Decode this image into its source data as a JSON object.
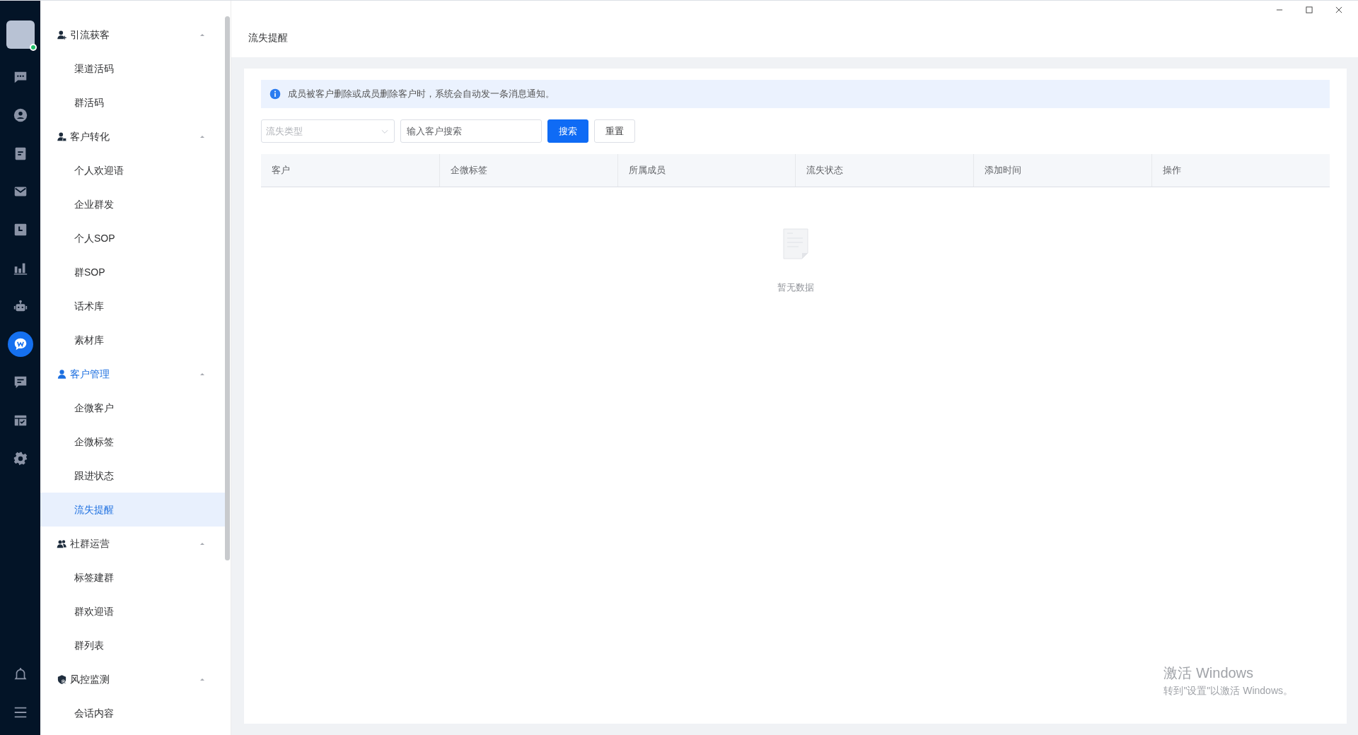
{
  "rail": {
    "items": [
      {
        "selected": false
      },
      {
        "selected": false
      },
      {
        "selected": false
      },
      {
        "selected": false
      },
      {
        "selected": false
      },
      {
        "selected": false
      },
      {
        "selected": false
      },
      {
        "selected": true
      },
      {
        "selected": false
      },
      {
        "selected": false
      },
      {
        "selected": false
      }
    ]
  },
  "sidebar": {
    "groups": [
      {
        "label": "引流获客",
        "expanded": true,
        "selected": false,
        "children": [
          {
            "label": "渠道活码",
            "selected": false
          },
          {
            "label": "群活码",
            "selected": false
          }
        ]
      },
      {
        "label": "客户转化",
        "expanded": true,
        "selected": false,
        "children": [
          {
            "label": "个人欢迎语",
            "selected": false
          },
          {
            "label": "企业群发",
            "selected": false
          },
          {
            "label": "个人SOP",
            "selected": false
          },
          {
            "label": "群SOP",
            "selected": false
          },
          {
            "label": "话术库",
            "selected": false
          },
          {
            "label": "素材库",
            "selected": false
          }
        ]
      },
      {
        "label": "客户管理",
        "expanded": true,
        "selected": true,
        "children": [
          {
            "label": "企微客户",
            "selected": false
          },
          {
            "label": "企微标签",
            "selected": false
          },
          {
            "label": "跟进状态",
            "selected": false
          },
          {
            "label": "流失提醒",
            "selected": true
          }
        ]
      },
      {
        "label": "社群运营",
        "expanded": true,
        "selected": false,
        "children": [
          {
            "label": "标签建群",
            "selected": false
          },
          {
            "label": "群欢迎语",
            "selected": false
          },
          {
            "label": "群列表",
            "selected": false
          }
        ]
      },
      {
        "label": "风控监测",
        "expanded": true,
        "selected": false,
        "children": [
          {
            "label": "会话内容",
            "selected": false
          }
        ]
      }
    ]
  },
  "page": {
    "title": "流失提醒",
    "alert": "成员被客户删除或成员删除客户时，系统会自动发一条消息通知。",
    "filters": {
      "type_select": {
        "placeholder": "流失类型"
      },
      "search": {
        "placeholder": "输入客户搜索"
      },
      "buttons": [
        {
          "label": "搜索",
          "kind": "primary"
        },
        {
          "label": "重置",
          "kind": "default"
        }
      ]
    },
    "table": {
      "columns": [
        "客户",
        "企微标签",
        "所属成员",
        "流失状态",
        "添加时间",
        "操作"
      ],
      "empty_text": "暂无数据"
    }
  },
  "os_notice": {
    "title": "激活 Windows",
    "subtitle": "转到\"设置\"以激活 Windows。"
  }
}
